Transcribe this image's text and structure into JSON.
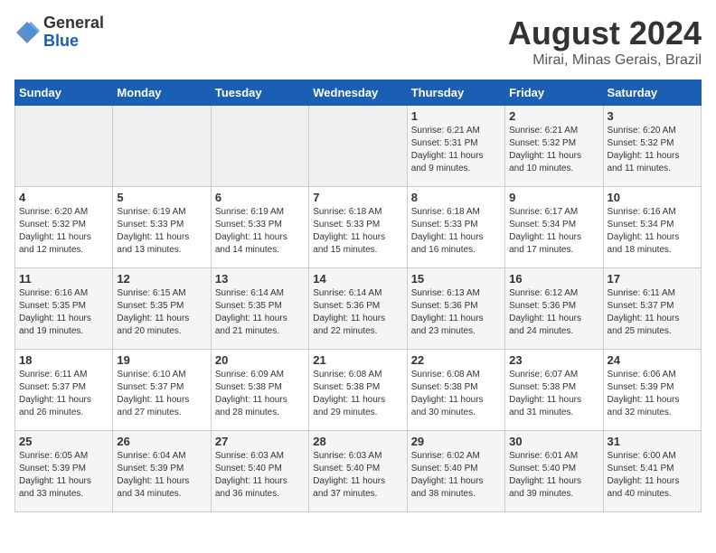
{
  "logo": {
    "general": "General",
    "blue": "Blue"
  },
  "title": "August 2024",
  "location": "Mirai, Minas Gerais, Brazil",
  "weekdays": [
    "Sunday",
    "Monday",
    "Tuesday",
    "Wednesday",
    "Thursday",
    "Friday",
    "Saturday"
  ],
  "weeks": [
    [
      {
        "day": "",
        "info": ""
      },
      {
        "day": "",
        "info": ""
      },
      {
        "day": "",
        "info": ""
      },
      {
        "day": "",
        "info": ""
      },
      {
        "day": "1",
        "info": "Sunrise: 6:21 AM\nSunset: 5:31 PM\nDaylight: 11 hours\nand 9 minutes."
      },
      {
        "day": "2",
        "info": "Sunrise: 6:21 AM\nSunset: 5:32 PM\nDaylight: 11 hours\nand 10 minutes."
      },
      {
        "day": "3",
        "info": "Sunrise: 6:20 AM\nSunset: 5:32 PM\nDaylight: 11 hours\nand 11 minutes."
      }
    ],
    [
      {
        "day": "4",
        "info": "Sunrise: 6:20 AM\nSunset: 5:32 PM\nDaylight: 11 hours\nand 12 minutes."
      },
      {
        "day": "5",
        "info": "Sunrise: 6:19 AM\nSunset: 5:33 PM\nDaylight: 11 hours\nand 13 minutes."
      },
      {
        "day": "6",
        "info": "Sunrise: 6:19 AM\nSunset: 5:33 PM\nDaylight: 11 hours\nand 14 minutes."
      },
      {
        "day": "7",
        "info": "Sunrise: 6:18 AM\nSunset: 5:33 PM\nDaylight: 11 hours\nand 15 minutes."
      },
      {
        "day": "8",
        "info": "Sunrise: 6:18 AM\nSunset: 5:33 PM\nDaylight: 11 hours\nand 16 minutes."
      },
      {
        "day": "9",
        "info": "Sunrise: 6:17 AM\nSunset: 5:34 PM\nDaylight: 11 hours\nand 17 minutes."
      },
      {
        "day": "10",
        "info": "Sunrise: 6:16 AM\nSunset: 5:34 PM\nDaylight: 11 hours\nand 18 minutes."
      }
    ],
    [
      {
        "day": "11",
        "info": "Sunrise: 6:16 AM\nSunset: 5:35 PM\nDaylight: 11 hours\nand 19 minutes."
      },
      {
        "day": "12",
        "info": "Sunrise: 6:15 AM\nSunset: 5:35 PM\nDaylight: 11 hours\nand 20 minutes."
      },
      {
        "day": "13",
        "info": "Sunrise: 6:14 AM\nSunset: 5:35 PM\nDaylight: 11 hours\nand 21 minutes."
      },
      {
        "day": "14",
        "info": "Sunrise: 6:14 AM\nSunset: 5:36 PM\nDaylight: 11 hours\nand 22 minutes."
      },
      {
        "day": "15",
        "info": "Sunrise: 6:13 AM\nSunset: 5:36 PM\nDaylight: 11 hours\nand 23 minutes."
      },
      {
        "day": "16",
        "info": "Sunrise: 6:12 AM\nSunset: 5:36 PM\nDaylight: 11 hours\nand 24 minutes."
      },
      {
        "day": "17",
        "info": "Sunrise: 6:11 AM\nSunset: 5:37 PM\nDaylight: 11 hours\nand 25 minutes."
      }
    ],
    [
      {
        "day": "18",
        "info": "Sunrise: 6:11 AM\nSunset: 5:37 PM\nDaylight: 11 hours\nand 26 minutes."
      },
      {
        "day": "19",
        "info": "Sunrise: 6:10 AM\nSunset: 5:37 PM\nDaylight: 11 hours\nand 27 minutes."
      },
      {
        "day": "20",
        "info": "Sunrise: 6:09 AM\nSunset: 5:38 PM\nDaylight: 11 hours\nand 28 minutes."
      },
      {
        "day": "21",
        "info": "Sunrise: 6:08 AM\nSunset: 5:38 PM\nDaylight: 11 hours\nand 29 minutes."
      },
      {
        "day": "22",
        "info": "Sunrise: 6:08 AM\nSunset: 5:38 PM\nDaylight: 11 hours\nand 30 minutes."
      },
      {
        "day": "23",
        "info": "Sunrise: 6:07 AM\nSunset: 5:38 PM\nDaylight: 11 hours\nand 31 minutes."
      },
      {
        "day": "24",
        "info": "Sunrise: 6:06 AM\nSunset: 5:39 PM\nDaylight: 11 hours\nand 32 minutes."
      }
    ],
    [
      {
        "day": "25",
        "info": "Sunrise: 6:05 AM\nSunset: 5:39 PM\nDaylight: 11 hours\nand 33 minutes."
      },
      {
        "day": "26",
        "info": "Sunrise: 6:04 AM\nSunset: 5:39 PM\nDaylight: 11 hours\nand 34 minutes."
      },
      {
        "day": "27",
        "info": "Sunrise: 6:03 AM\nSunset: 5:40 PM\nDaylight: 11 hours\nand 36 minutes."
      },
      {
        "day": "28",
        "info": "Sunrise: 6:03 AM\nSunset: 5:40 PM\nDaylight: 11 hours\nand 37 minutes."
      },
      {
        "day": "29",
        "info": "Sunrise: 6:02 AM\nSunset: 5:40 PM\nDaylight: 11 hours\nand 38 minutes."
      },
      {
        "day": "30",
        "info": "Sunrise: 6:01 AM\nSunset: 5:40 PM\nDaylight: 11 hours\nand 39 minutes."
      },
      {
        "day": "31",
        "info": "Sunrise: 6:00 AM\nSunset: 5:41 PM\nDaylight: 11 hours\nand 40 minutes."
      }
    ]
  ]
}
